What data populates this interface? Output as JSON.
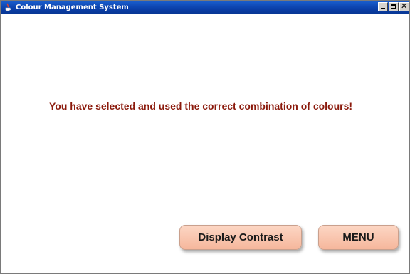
{
  "window": {
    "title": "Colour Management System",
    "controls": {
      "minimize_icon": "minimize-icon",
      "maximize_icon": "maximize-icon",
      "close_icon": "close-icon"
    }
  },
  "main": {
    "message": "You have selected and used the correct combination of colours!"
  },
  "buttons": {
    "display_contrast": "Display Contrast",
    "menu": "MENU"
  },
  "colors": {
    "titlebar": "#0a3ea8",
    "message_text": "#8b1a0c",
    "button_fill": "#f6b79c"
  }
}
